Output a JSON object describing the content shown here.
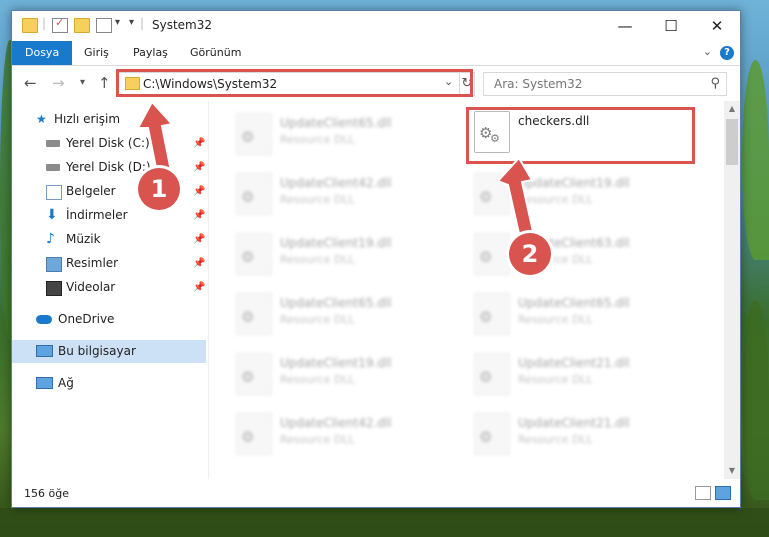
{
  "window": {
    "title": "System32",
    "tabs": [
      "Dosya",
      "Giriş",
      "Paylaş",
      "Görünüm"
    ],
    "help_label": "?"
  },
  "navigation": {
    "address": "C:\\Windows\\System32",
    "search_placeholder": "Ara: System32"
  },
  "sidebar": {
    "items": [
      {
        "label": "Hızlı erişim",
        "icon": "star-icon",
        "pinned": false
      },
      {
        "label": "Yerel Disk (C:)",
        "icon": "drive-icon",
        "pinned": true
      },
      {
        "label": "Yerel Disk (D:)",
        "icon": "drive-icon",
        "pinned": true
      },
      {
        "label": "Belgeler",
        "icon": "documents-icon",
        "pinned": true
      },
      {
        "label": "İndirmeler",
        "icon": "download-icon",
        "pinned": true
      },
      {
        "label": "Müzik",
        "icon": "music-icon",
        "pinned": true
      },
      {
        "label": "Resimler",
        "icon": "pictures-icon",
        "pinned": true
      },
      {
        "label": "Videolar",
        "icon": "video-icon",
        "pinned": true
      },
      {
        "label": "OneDrive",
        "icon": "cloud-icon",
        "pinned": false
      },
      {
        "label": "Bu bilgisayar",
        "icon": "computer-icon",
        "pinned": false
      },
      {
        "label": "Ağ",
        "icon": "network-icon",
        "pinned": false
      }
    ]
  },
  "files": [
    {
      "name": "UpdateClient65.dll",
      "type": "Resource DLL"
    },
    {
      "name": "checkers.dll",
      "type": ""
    },
    {
      "name": "UpdateClient42.dll",
      "type": "Resource DLL"
    },
    {
      "name": "UpdateClient19.dll",
      "type": "Resource DLL"
    },
    {
      "name": "UpdateClient19.dll",
      "type": "Resource DLL"
    },
    {
      "name": "UpdateClient63.dll",
      "type": "Resource DLL"
    },
    {
      "name": "UpdateClient65.dll",
      "type": "Resource DLL"
    },
    {
      "name": "UpdateClient65.dll",
      "type": "Resource DLL"
    },
    {
      "name": "UpdateClient19.dll",
      "type": "Resource DLL"
    },
    {
      "name": "UpdateClient21.dll",
      "type": "Resource DLL"
    },
    {
      "name": "UpdateClient42.dll",
      "type": "Resource DLL"
    },
    {
      "name": "UpdateClient21.dll",
      "type": "Resource DLL"
    }
  ],
  "status": {
    "item_count": "156 öğe"
  },
  "annotations": {
    "step1": "1",
    "step2": "2",
    "color": "#d9534f"
  },
  "colors": {
    "accent": "#1979ca",
    "selected": "#cce1f5"
  }
}
